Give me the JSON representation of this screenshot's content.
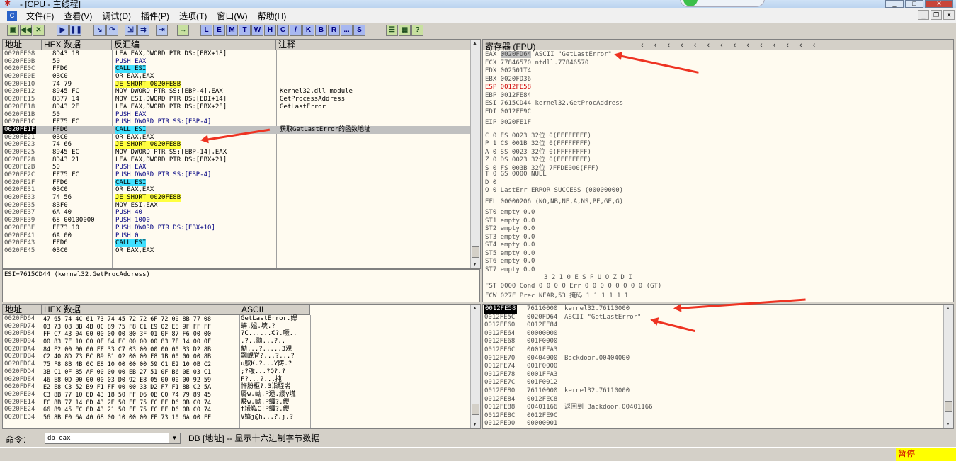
{
  "window": {
    "title": "- [CPU - 主线程]"
  },
  "menu": [
    "文件(F)",
    "查看(V)",
    "调试(D)",
    "插件(P)",
    "选项(T)",
    "窗口(W)",
    "帮助(H)"
  ],
  "toolbar_letters": [
    "L",
    "E",
    "M",
    "T",
    "W",
    "H",
    "C",
    "/",
    "K",
    "B",
    "R",
    "...",
    "S"
  ],
  "disasm": {
    "headers": {
      "addr": "地址",
      "hex": "HEX 数据",
      "dis": "反汇编",
      "comment": "注释"
    },
    "rows": [
      {
        "a": "0020FE08",
        "h": "8D43 18",
        "d": "LEA EAX,DWORD PTR DS:[EBX+18]",
        "c": ""
      },
      {
        "a": "0020FE0B",
        "h": "50",
        "d": "PUSH EAX",
        "c": ""
      },
      {
        "a": "0020FE0C",
        "h": "FFD6",
        "d": "CALL ESI",
        "c": ""
      },
      {
        "a": "0020FE0E",
        "h": "0BC0",
        "d": "OR EAX,EAX",
        "c": ""
      },
      {
        "a": "0020FE10",
        "h": "74 79",
        "d": "JE SHORT 0020FE8B",
        "c": ""
      },
      {
        "a": "0020FE12",
        "h": "8945 FC",
        "d": "MOV DWORD PTR SS:[EBP-4],EAX",
        "c": "Kernel32.dll module"
      },
      {
        "a": "0020FE15",
        "h": "8B77 14",
        "d": "MOV ESI,DWORD PTR DS:[EDI+14]",
        "c": "GetProcessAddress"
      },
      {
        "a": "0020FE18",
        "h": "8D43 2E",
        "d": "LEA EAX,DWORD PTR DS:[EBX+2E]",
        "c": "GetLastError"
      },
      {
        "a": "0020FE1B",
        "h": "50",
        "d": "PUSH EAX",
        "c": ""
      },
      {
        "a": "0020FE1C",
        "h": "FF75 FC",
        "d": "PUSH DWORD PTR SS:[EBP-4]",
        "c": ""
      },
      {
        "a": "0020FE1F",
        "h": "FFD6",
        "d": "CALL ESI",
        "c": "获取GetLastError的函数地址"
      },
      {
        "a": "0020FE21",
        "h": "0BC0",
        "d": "OR EAX,EAX",
        "c": ""
      },
      {
        "a": "0020FE23",
        "h": "74 66",
        "d": "JE SHORT 0020FE8B",
        "c": ""
      },
      {
        "a": "0020FE25",
        "h": "8945 EC",
        "d": "MOV DWORD PTR SS:[EBP-14],EAX",
        "c": ""
      },
      {
        "a": "0020FE28",
        "h": "8D43 21",
        "d": "LEA EAX,DWORD PTR DS:[EBX+21]",
        "c": ""
      },
      {
        "a": "0020FE2B",
        "h": "50",
        "d": "PUSH EAX",
        "c": ""
      },
      {
        "a": "0020FE2C",
        "h": "FF75 FC",
        "d": "PUSH DWORD PTR SS:[EBP-4]",
        "c": ""
      },
      {
        "a": "0020FE2F",
        "h": "FFD6",
        "d": "CALL ESI",
        "c": ""
      },
      {
        "a": "0020FE31",
        "h": "0BC0",
        "d": "OR EAX,EAX",
        "c": ""
      },
      {
        "a": "0020FE33",
        "h": "74 56",
        "d": "JE SHORT 0020FE8B",
        "c": ""
      },
      {
        "a": "0020FE35",
        "h": "8BF0",
        "d": "MOV ESI,EAX",
        "c": ""
      },
      {
        "a": "0020FE37",
        "h": "6A 40",
        "d": "PUSH 40",
        "c": ""
      },
      {
        "a": "0020FE39",
        "h": "68 00100000",
        "d": "PUSH 1000",
        "c": ""
      },
      {
        "a": "0020FE3E",
        "h": "FF73 10",
        "d": "PUSH DWORD PTR DS:[EBX+10]",
        "c": ""
      },
      {
        "a": "0020FE41",
        "h": "6A 00",
        "d": "PUSH 0",
        "c": ""
      },
      {
        "a": "0020FE43",
        "h": "FFD6",
        "d": "CALL ESI",
        "c": ""
      },
      {
        "a": "0020FE45",
        "h": "0BC0",
        "d": "OR EAX,EAX",
        "c": ""
      }
    ],
    "selected_index": 10
  },
  "info_line": "ESI=7615CD44 (kernel32.GetProcAddress)",
  "registers": {
    "title": "寄存器 (FPU)",
    "eax": {
      "name": "EAX",
      "val": "0020FD64",
      "cmt": "ASCII \"GetLastError\""
    },
    "lines": [
      "ECX 77846570 ntdll.77846570",
      "EDX 002501T4",
      "EBX 0020FD36",
      "ESP 0012FE58",
      "EBP 0012FE84",
      "ESI 7615CD44 kernel32.GetProcAddress",
      "EDI 0012FE9C"
    ],
    "eip": "EIP 0020FE1F",
    "flags": [
      "C 0  ES 0023 32位 0(FFFFFFFF)",
      "P 1  CS 001B 32位 0(FFFFFFFF)",
      "A 0  SS 0023 32位 0(FFFFFFFF)",
      "Z 0  DS 0023 32位 0(FFFFFFFF)",
      "S 0  FS 003B 32位 7FFDE000(FFF)",
      "T 0  GS 0000 NULL",
      "D 0",
      "O 0  LastErr ERROR_SUCCESS (00000000)"
    ],
    "efl": "EFL 00000206 (NO,NB,NE,A,NS,PE,GE,G)",
    "fpu": [
      "ST0 empty 0.0",
      "ST1 empty 0.0",
      "ST2 empty 0.0",
      "ST3 empty 0.0",
      "ST4 empty 0.0",
      "ST5 empty 0.0",
      "ST6 empty 0.0",
      "ST7 empty 0.0"
    ],
    "fpu_hdr": "3 2 1 0      E S P U O Z D I",
    "fst": "FST 0000  Cond 0 0 0 0  Err 0 0 0 0 0 0 0 0  (GT)",
    "fcw": "FCW 027F  Prec NEAR,53  掩码    1 1 1 1 1 1"
  },
  "dump": {
    "headers": {
      "addr": "地址",
      "hex": "HEX 数据",
      "ascii": "ASCII"
    },
    "rows": [
      {
        "a": "0020FD64",
        "h": "47 65 74 4C 61 73 74 45 72 72 6F 72 00 8B 77 08",
        "s": "GetLastError.媤"
      },
      {
        "a": "0020FD74",
        "h": "03 73 08 8B 4B 0C 89 75 F8 C1 E9 02 E8 9F FF FF",
        "s": "蠎.媼.塽.?"
      },
      {
        "a": "0020FD84",
        "h": "FF C7 43 04 00 00 00 00 80 3F 01 0F 87 F6 00 00",
        "s": "?C......€?.噘.."
      },
      {
        "a": "0020FD94",
        "h": "00 83 7F 10 00 0F 84 EC 00 00 00 83 7F 14 00 0F",
        "s": ".?..勳...?.."
      },
      {
        "a": "0020FDA4",
        "h": "84 E2 00 00 00 FF 33 C7 03 00 00 00 00 33 D2 8B",
        "s": "勨...?.....3覌"
      },
      {
        "a": "0020FDB4",
        "h": "C2 40 8D 73 BC B9 B1 02 00 00 E8 1B 00 00 00 8B",
        "s": "翤峴脊?...?...?"
      },
      {
        "a": "0020FDC4",
        "h": "75 F8 8B 4B 0C E8 10 00 00 00 59 C1 E2 10 0B C2",
        "s": "u鴥K.?...Y陦.?"
      },
      {
        "a": "0020FDD4",
        "h": "3B C1 0F 85 AF 00 00 00 EB 27 51 0F B6 0E 03 C1",
        "s": ";?叆...?Q?.?"
      },
      {
        "a": "0020FDE4",
        "h": "46 E8 0D 00 00 00 03 D0 92 E8 05 00 00 00 92 59",
        "s": "F?...?...扽"
      },
      {
        "a": "0020FDF4",
        "h": "E2 E8 C3 52 B9 F1 FF 00 00 33 D2 F7 F1 8B C2 5A",
        "s": "忤肦柜?.3诣駤耑"
      },
      {
        "a": "0020FE04",
        "h": "C3 8B 77 10 8D 43 18 50 FF D6 0B C0 74 79 89 45",
        "s": "脣w.岰.P逯.纓y塃"
      },
      {
        "a": "0020FE14",
        "h": "FC 8B 77 14 8D 43 2E 50 FF 75 FC FF D6 0B C0 74",
        "s": "鼖w.岰.P鱱?.纓"
      },
      {
        "a": "0020FE24",
        "h": "66 89 45 EC 8D 43 21 50 FF 75 FC FF D6 0B C0 74",
        "s": "f塃鞃C!P鱱?.纓"
      },
      {
        "a": "0020FE34",
        "h": "56 8B F0 6A 40 68 00 10 00 00 FF 73 10 6A 00 FF",
        "s": "V嬸j@h...?.j.?"
      }
    ]
  },
  "stack": {
    "rows": [
      {
        "a": "0012FE58",
        "v": "76110000",
        "c": "kernel32.76110000"
      },
      {
        "a": "0012FE5C",
        "v": "0020FD64",
        "c": "ASCII \"GetLastError\""
      },
      {
        "a": "0012FE60",
        "v": "0012FE84",
        "c": ""
      },
      {
        "a": "0012FE64",
        "v": "00000000",
        "c": ""
      },
      {
        "a": "0012FE68",
        "v": "001F0000",
        "c": ""
      },
      {
        "a": "0012FE6C",
        "v": "0001FFA3",
        "c": ""
      },
      {
        "a": "0012FE70",
        "v": "00404000",
        "c": "Backdoor.00404000"
      },
      {
        "a": "0012FE74",
        "v": "001F0000",
        "c": ""
      },
      {
        "a": "0012FE78",
        "v": "0001FFA3",
        "c": ""
      },
      {
        "a": "0012FE7C",
        "v": "001F0012",
        "c": ""
      },
      {
        "a": "0012FE80",
        "v": "76110000",
        "c": "kernel32.76110000"
      },
      {
        "a": "0012FE84",
        "v": "0012FEC8",
        "c": ""
      },
      {
        "a": "0012FE88",
        "v": "00401166",
        "c": "返回到 Backdoor.00401166"
      },
      {
        "a": "0012FE8C",
        "v": "0012FE9C",
        "c": ""
      },
      {
        "a": "0012FE90",
        "v": "00000001",
        "c": ""
      }
    ]
  },
  "command": {
    "label": "命令：",
    "value": "db eax",
    "help": "DB [地址] -- 显示十六进制字节数据"
  },
  "status": {
    "paused": "暂停"
  }
}
